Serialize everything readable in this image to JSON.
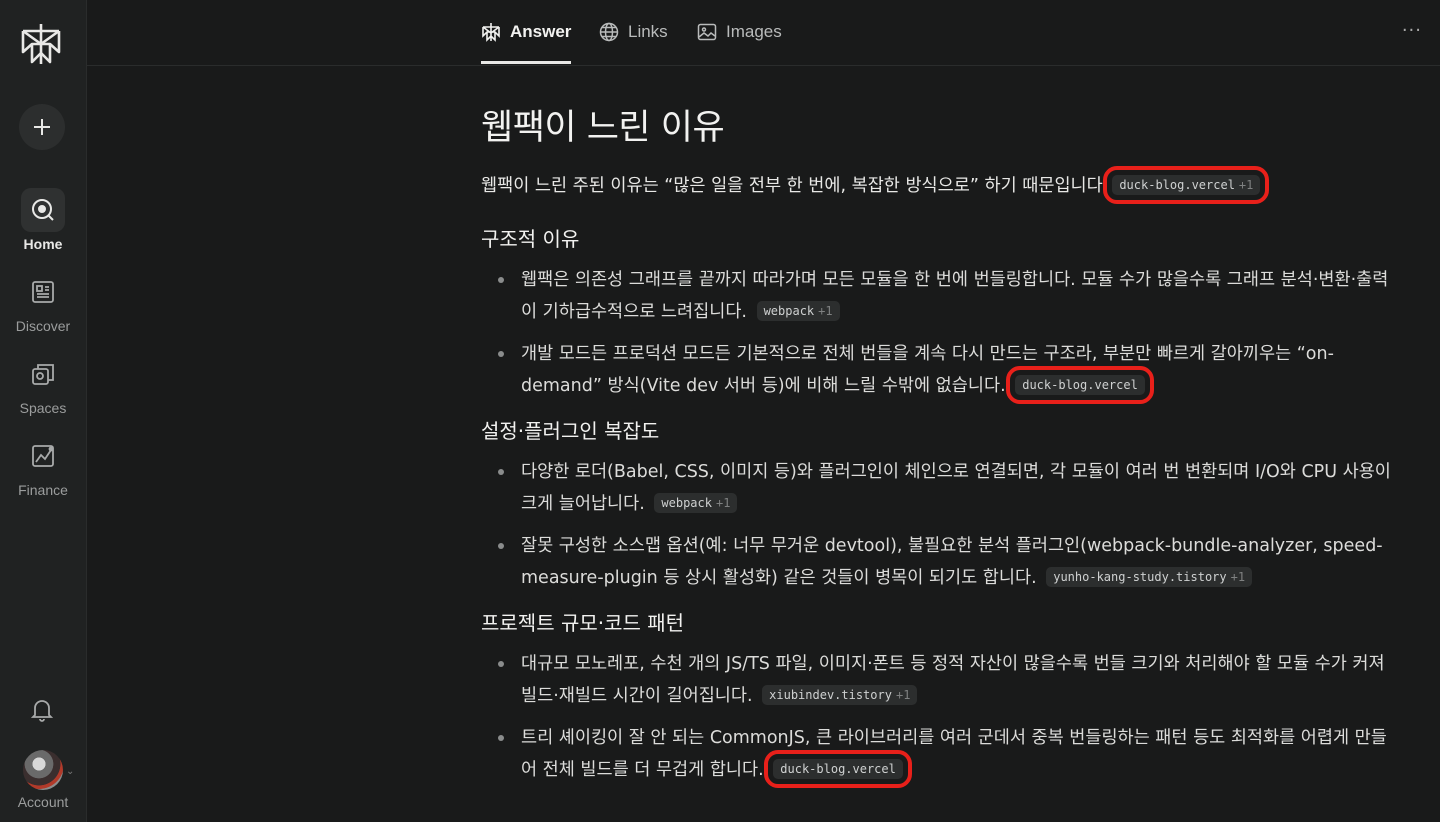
{
  "sidebar": {
    "new_label": "+",
    "items": [
      {
        "label": "Home",
        "icon": "home-search-icon",
        "active": true
      },
      {
        "label": "Discover",
        "icon": "discover-icon"
      },
      {
        "label": "Spaces",
        "icon": "spaces-icon"
      },
      {
        "label": "Finance",
        "icon": "finance-icon"
      }
    ],
    "account_label": "Account"
  },
  "tabs": [
    {
      "label": "Answer",
      "icon": "answer-icon",
      "active": true
    },
    {
      "label": "Links",
      "icon": "globe-icon"
    },
    {
      "label": "Images",
      "icon": "image-icon"
    }
  ],
  "more_label": "···",
  "answer": {
    "title": "웹팩이 느린 이유",
    "intro": "웹팩이 느린 주된 이유는 “많은 일을 전부 한 번에, 복잡한 방식으로” 하기 때문입니다",
    "intro_cite": {
      "source": "duck-blog.vercel",
      "extra": "+1"
    },
    "sections": [
      {
        "heading": "구조적 이유",
        "bullets": [
          {
            "text": "웹팩은 의존성 그래프를 끝까지 따라가며 모든 모듈을 한 번에 번들링합니다. 모듈 수가 많을수록 그래프 분석·변환·출력이 기하급수적으로 느려집니다.",
            "source": "webpack",
            "extra": "+1"
          },
          {
            "text": "개발 모드든 프로덕션 모드든 기본적으로 전체 번들을 계속 다시 만드는 구조라, 부분만 빠르게 갈아끼우는 “on-demand” 방식(Vite dev 서버 등)에 비해 느릴 수밖에 없습니다.",
            "source": "duck-blog.vercel",
            "extra": ""
          }
        ]
      },
      {
        "heading": "설정·플러그인 복잡도",
        "bullets": [
          {
            "text": "다양한 로더(Babel, CSS, 이미지 등)와 플러그인이 체인으로 연결되면, 각 모듈이 여러 번 변환되며 I/O와 CPU 사용이 크게 늘어납니다.",
            "source": "webpack",
            "extra": "+1"
          },
          {
            "text": "잘못 구성한 소스맵 옵션(예: 너무 무거운 devtool), 불필요한 분석 플러그인(webpack-bundle-analyzer, speed-measure-plugin 등 상시 활성화) 같은 것들이 병목이 되기도 합니다.",
            "source": "yunho-kang-study.tistory",
            "extra": "+1"
          }
        ]
      },
      {
        "heading": "프로젝트 규모·코드 패턴",
        "bullets": [
          {
            "text": "대규모 모노레포, 수천 개의 JS/TS 파일, 이미지·폰트 등 정적 자산이 많을수록 번들 크기와 처리해야 할 모듈 수가 커져 빌드·재빌드 시간이 길어집니다.",
            "source": "xiubindev.tistory",
            "extra": "+1"
          },
          {
            "text": "트리 셰이킹이 잘 안 되는 CommonJS, 큰 라이브러리를 여러 군데서 중복 번들링하는 패턴 등도 최적화를 어렵게 만들어 전체 빌드를 더 무겁게 합니다.",
            "source": "duck-blog.vercel",
            "extra": ""
          }
        ]
      }
    ]
  },
  "colors": {
    "background": "#191a1a",
    "sidebar": "#202222",
    "highlight_box": "#e8201a",
    "citation_bg": "#2c2e2e"
  }
}
